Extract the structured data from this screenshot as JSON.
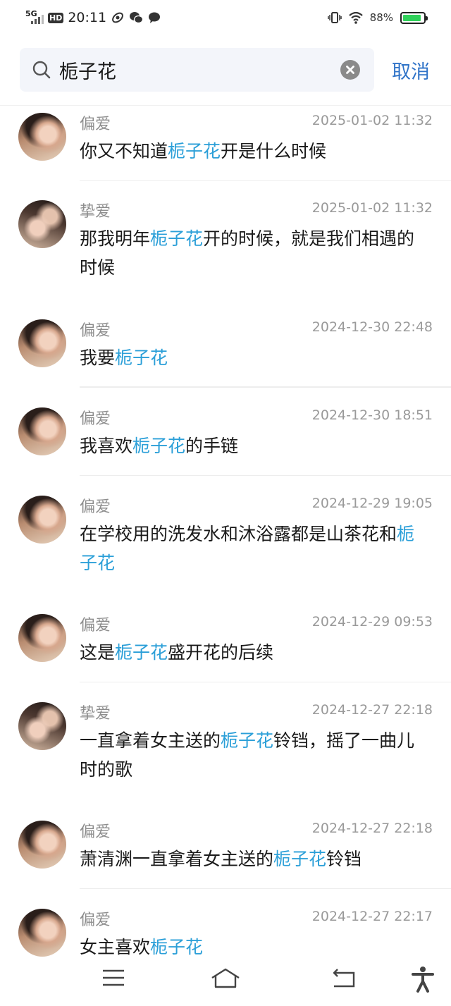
{
  "status_bar": {
    "network": "5G",
    "hd": "HD",
    "time": "20:11",
    "battery_percent": "88%",
    "battery_level": 0.88,
    "battery_color": "#2fd15a"
  },
  "search": {
    "query": "栀子花",
    "cancel_label": "取消"
  },
  "theme": {
    "highlight_color": "#2b9fd8",
    "accent_color": "#2f73c8"
  },
  "results": [
    {
      "name": "偏爱",
      "time": "2025-01-02 11:32",
      "msg_pre": "你又不知道",
      "msg_hl": "栀子花",
      "msg_post": "开是什么时候",
      "avatar": "a1"
    },
    {
      "name": "挚爱",
      "time": "2025-01-02 11:32",
      "msg_pre": "那我明年",
      "msg_hl": "栀子花",
      "msg_post": "开的时候，就是我们相遇的时候",
      "avatar": "a2"
    },
    {
      "name": "偏爱",
      "time": "2024-12-30 22:48",
      "msg_pre": "我要",
      "msg_hl": "栀子花",
      "msg_post": "",
      "avatar": "a1"
    },
    {
      "name": "偏爱",
      "time": "2024-12-30 18:51",
      "msg_pre": "我喜欢",
      "msg_hl": "栀子花",
      "msg_post": "的手链",
      "avatar": "a1"
    },
    {
      "name": "偏爱",
      "time": "2024-12-29 19:05",
      "msg_pre": "在学校用的洗发水和沐浴露都是山茶花和",
      "msg_hl": "栀子花",
      "msg_post": "",
      "avatar": "a1"
    },
    {
      "name": "偏爱",
      "time": "2024-12-29 09:53",
      "msg_pre": "这是",
      "msg_hl": "栀子花",
      "msg_post": "盛开花的后续",
      "avatar": "a1"
    },
    {
      "name": "挚爱",
      "time": "2024-12-27 22:18",
      "msg_pre": "一直拿着女主送的",
      "msg_hl": "栀子花",
      "msg_post": "铃铛，摇了一曲儿时的歌",
      "avatar": "a2"
    },
    {
      "name": "偏爱",
      "time": "2024-12-27 22:18",
      "msg_pre": "萧清渊一直拿着女主送的",
      "msg_hl": "栀子花",
      "msg_post": "铃铛",
      "avatar": "a1"
    },
    {
      "name": "偏爱",
      "time": "2024-12-27 22:17",
      "msg_pre": "女主喜欢",
      "msg_hl": "栀子花",
      "msg_post": "",
      "avatar": "a1"
    }
  ],
  "nav_bar": {
    "icons": [
      "menu-icon",
      "home-icon",
      "back-icon",
      "accessibility-icon"
    ]
  }
}
